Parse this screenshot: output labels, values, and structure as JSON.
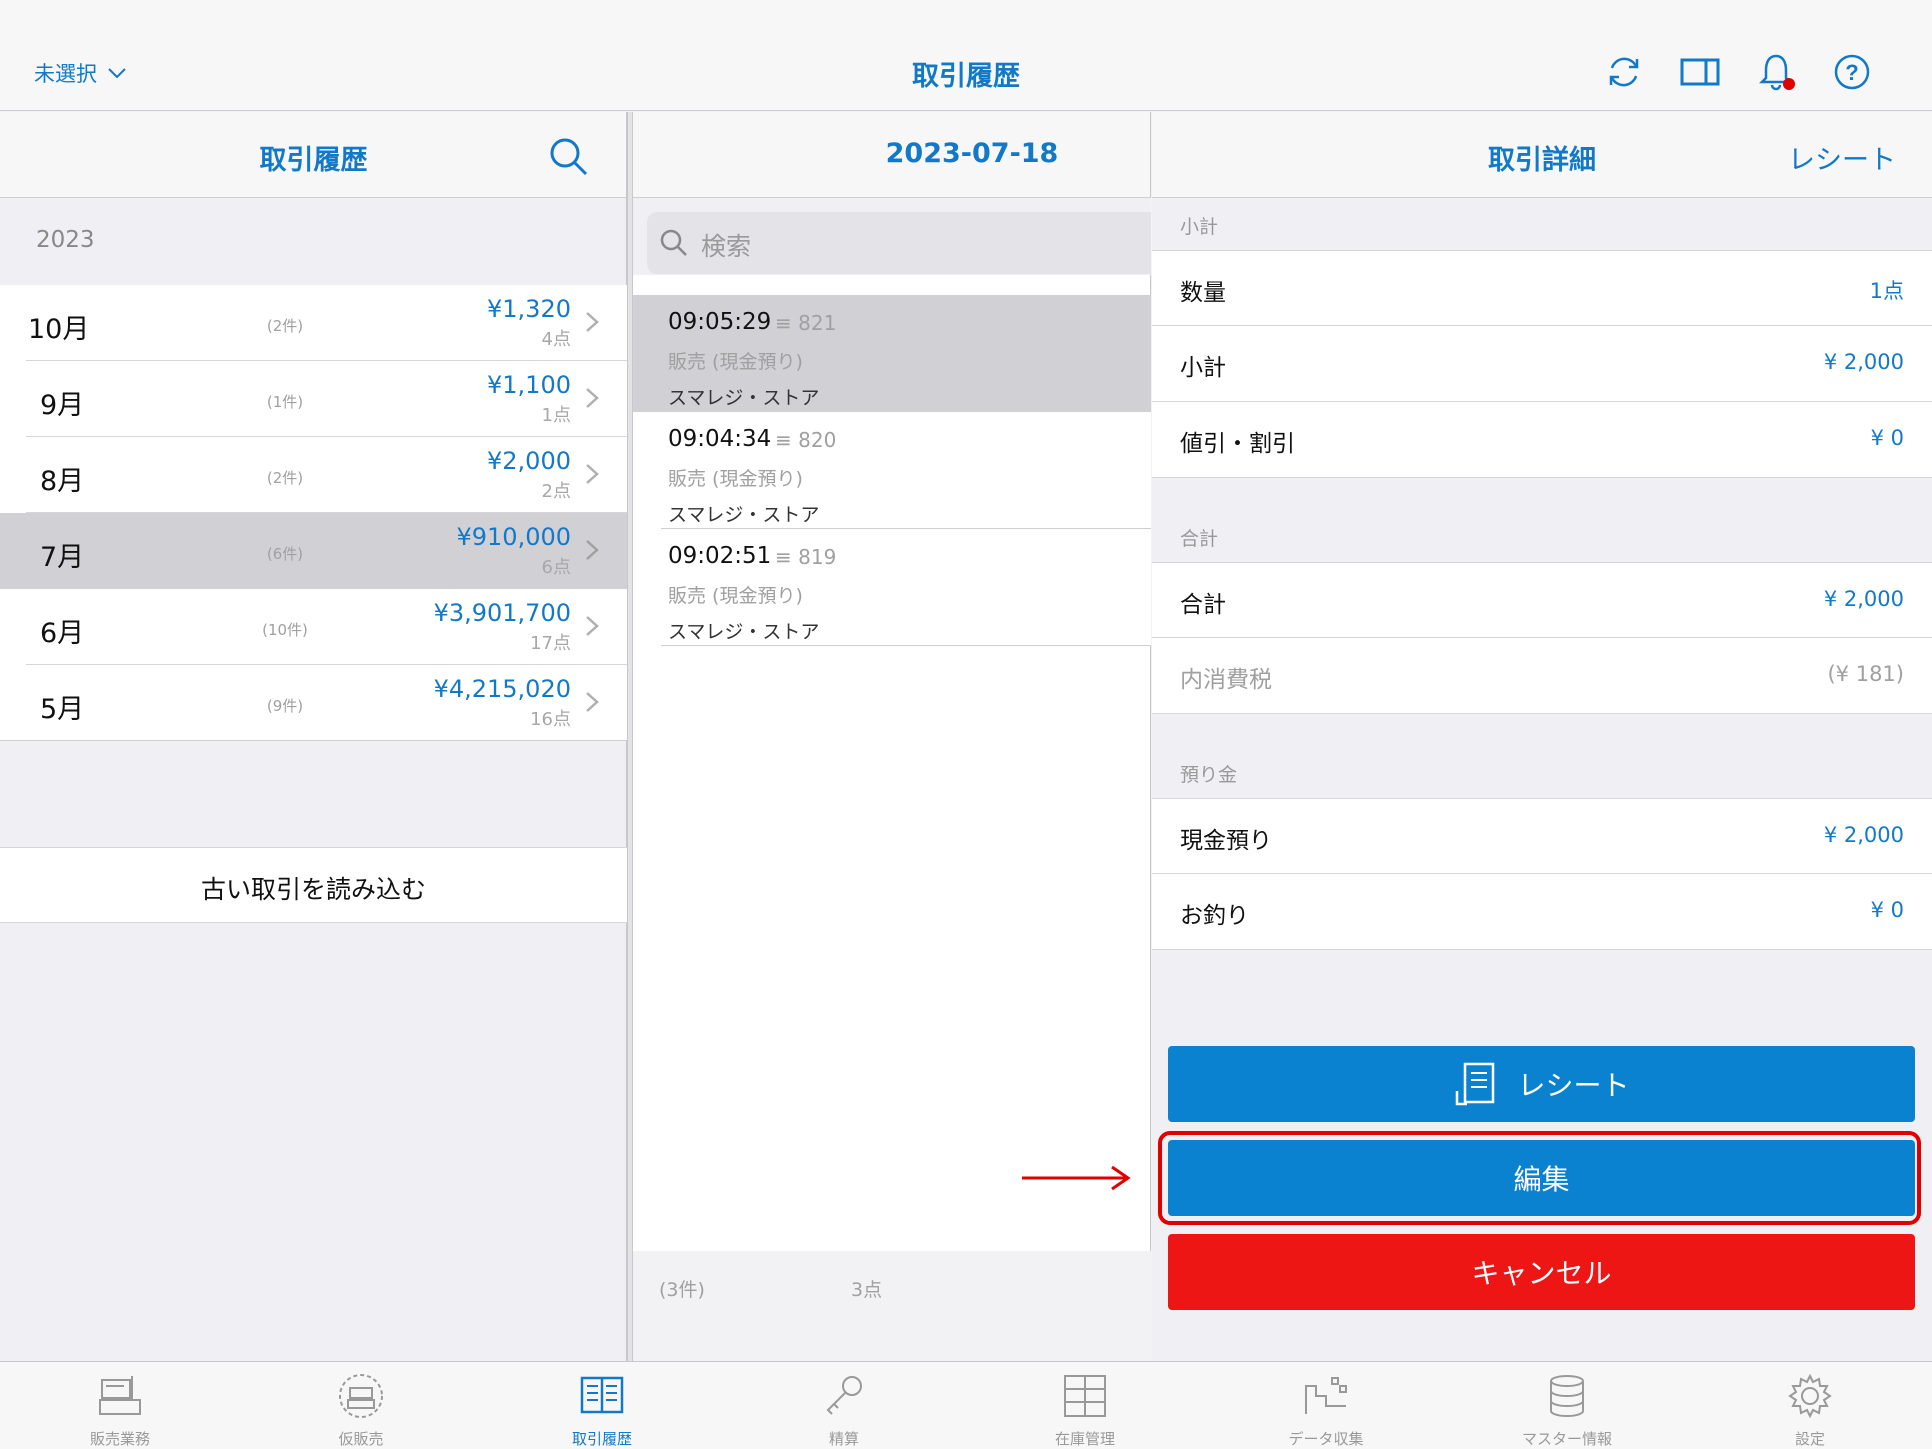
{
  "header": {
    "store_select": "未選択",
    "title": "取引履歴"
  },
  "icons": {
    "refresh": "refresh-icon",
    "split_view": "split-view-icon",
    "notifications": "bell-icon",
    "help": "help-icon"
  },
  "history_pane": {
    "title": "取引履歴",
    "year": "2023",
    "months": [
      {
        "label": "10月",
        "count": "(2件)",
        "amount": "¥1,320",
        "items": "4点"
      },
      {
        "label": "9月",
        "count": "(1件)",
        "amount": "¥1,100",
        "items": "1点"
      },
      {
        "label": "8月",
        "count": "(2件)",
        "amount": "¥2,000",
        "items": "2点"
      },
      {
        "label": "7月",
        "count": "(6件)",
        "amount": "¥910,000",
        "items": "6点"
      },
      {
        "label": "6月",
        "count": "(10件)",
        "amount": "¥3,901,700",
        "items": "17点"
      },
      {
        "label": "5月",
        "count": "(9件)",
        "amount": "¥4,215,020",
        "items": "16点"
      }
    ],
    "selected_index": 3,
    "load_older": "古い取引を読み込む"
  },
  "day_pane": {
    "title": "2023-07-18",
    "search_placeholder": "検索",
    "transactions": [
      {
        "time": "09:05:29",
        "number": "821",
        "type": "販売 (現金預り)",
        "store": "スマレジ・ストア"
      },
      {
        "time": "09:04:34",
        "number": "820",
        "type": "販売 (現金預り)",
        "store": "スマレジ・ストア"
      },
      {
        "time": "09:02:51",
        "number": "819",
        "type": "販売 (現金預り)",
        "store": "スマレジ・ストア"
      }
    ],
    "selected_index": 0,
    "footer_count": "(3件)",
    "footer_items": "3点"
  },
  "detail_pane": {
    "title": "取引詳細",
    "receipt_link": "レシート",
    "sections": {
      "subtotal_label": "小計",
      "total_label": "合計",
      "deposit_label": "預り金"
    },
    "rows": {
      "quantity": {
        "label": "数量",
        "value": "1点"
      },
      "subtotal": {
        "label": "小計",
        "value": "¥ 2,000"
      },
      "discount": {
        "label": "値引・割引",
        "value": "¥ 0"
      },
      "total": {
        "label": "合計",
        "value": "¥ 2,000"
      },
      "tax": {
        "label": "内消費税",
        "value": "(¥ 181)"
      },
      "cash": {
        "label": "現金預り",
        "value": "¥ 2,000"
      },
      "change": {
        "label": "お釣り",
        "value": "¥ 0"
      }
    },
    "buttons": {
      "receipt": "レシート",
      "edit": "編集",
      "cancel": "キャンセル"
    }
  },
  "tabs": [
    {
      "label": "販売業務",
      "icon": "register-icon"
    },
    {
      "label": "仮販売",
      "icon": "temp-sale-icon"
    },
    {
      "label": "取引履歴",
      "icon": "history-book-icon"
    },
    {
      "label": "精算",
      "icon": "key-icon"
    },
    {
      "label": "在庫管理",
      "icon": "cabinet-icon"
    },
    {
      "label": "データ収集",
      "icon": "data-collect-icon"
    },
    {
      "label": "マスター情報",
      "icon": "database-icon"
    },
    {
      "label": "設定",
      "icon": "gear-icon"
    }
  ],
  "colors": {
    "accent": "#1279c8",
    "button_blue": "#0a82d0",
    "cancel_red": "#ee1515",
    "highlight_red": "#e00000",
    "selected_row": "#d1d1d5"
  }
}
